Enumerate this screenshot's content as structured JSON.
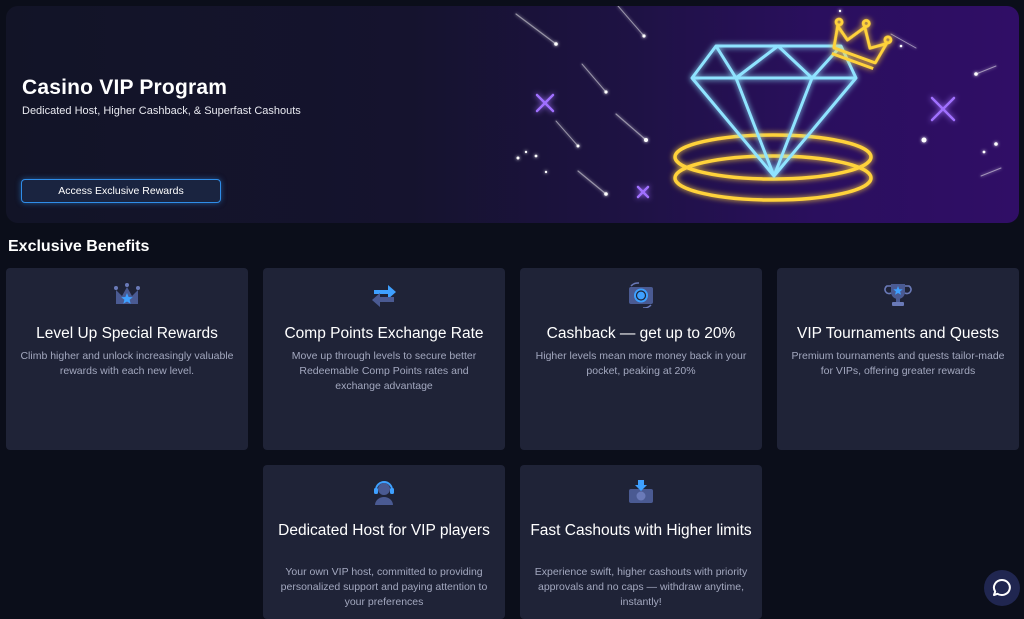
{
  "hero": {
    "title": "Casino VIP Program",
    "subtitle": "Dedicated Host, Higher Cashback, & Superfast Cashouts",
    "cta_label": "Access Exclusive Rewards"
  },
  "benefits": {
    "heading": "Exclusive Benefits",
    "cards": [
      {
        "icon": "crown-star-icon",
        "title": "Level Up Special Rewards",
        "description": "Climb higher and unlock increasingly valuable rewards with each new level."
      },
      {
        "icon": "exchange-arrows-icon",
        "title": "Comp Points Exchange Rate",
        "description": "Move up through levels to secure better Redeemable Comp Points rates and exchange advantage"
      },
      {
        "icon": "cashback-coin-icon",
        "title": "Cashback — get up to 20%",
        "description": "Higher levels mean more money back in your pocket, peaking at 20%"
      },
      {
        "icon": "trophy-icon",
        "title": "VIP Tournaments and Quests",
        "description": "Premium tournaments and quests tailor-made for VIPs, offering greater rewards"
      },
      {
        "icon": "host-headset-icon",
        "title": "Dedicated Host for VIP players",
        "description": "Your own VIP host, committed to providing personalized support and paying attention to your preferences"
      },
      {
        "icon": "fast-cashout-icon",
        "title": "Fast Cashouts with Higher limits",
        "description": "Experience swift, higher cashouts with priority approvals and no caps — withdraw anytime, instantly!"
      }
    ]
  },
  "chat": {
    "icon": "chat-bubble-icon"
  },
  "colors": {
    "page_bg": "#0b0e1a",
    "card_bg": "#1f2337",
    "accent_blue": "#2f8de8",
    "neon_gold": "#ffd23a",
    "neon_cyan": "#8fe3ff",
    "sparkle_purple": "#a070ff"
  }
}
